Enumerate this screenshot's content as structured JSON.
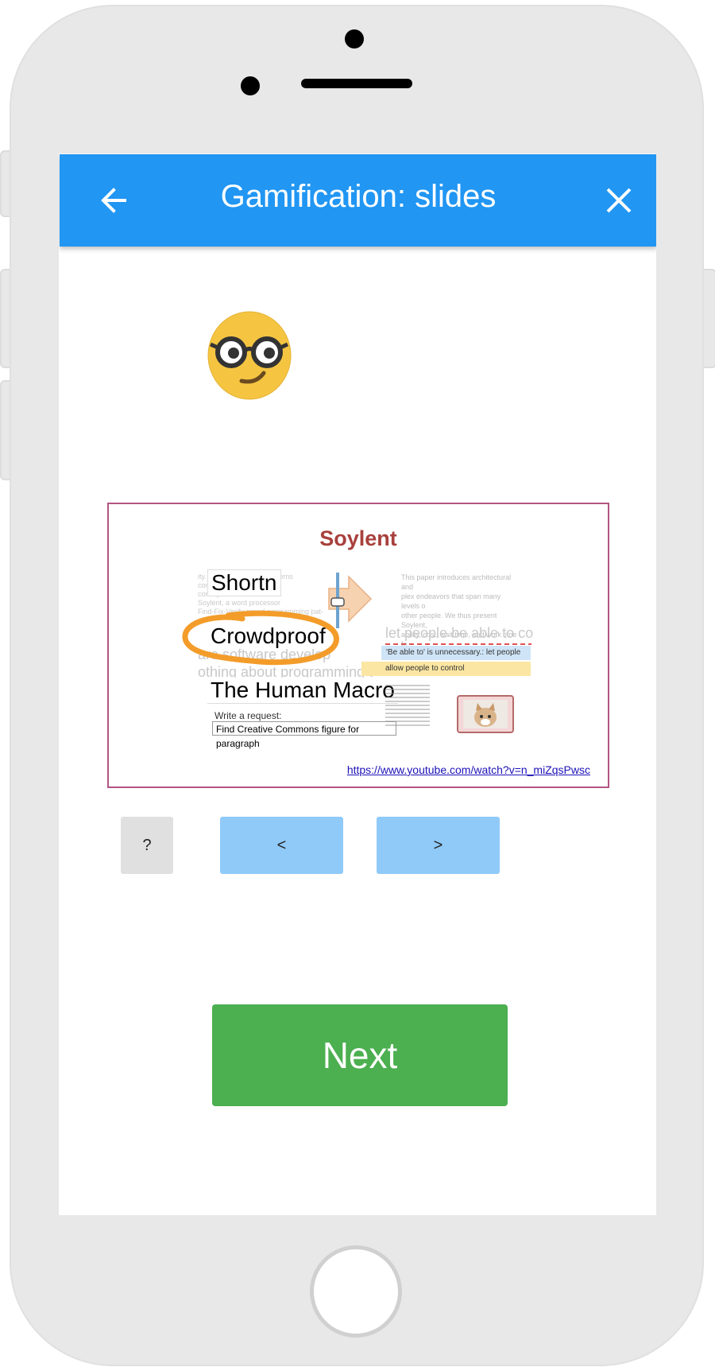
{
  "app": {
    "title": "Gamification: slides"
  },
  "icons": {
    "back": "arrow-left-icon",
    "close": "close-icon",
    "emoji": "nerd-face-emoji"
  },
  "slide": {
    "title": "Soylent",
    "labels": {
      "shortn": "Shortn",
      "crowdproof": "Crowdproof",
      "human_macro": "The Human Macro"
    },
    "request_label": "Write a request:",
    "request_input": "Find Creative Commons figure for paragraph",
    "suggestion_phrase": "let people be able to co",
    "suggestion_1": "'Be able to' is unnecessary.: let people",
    "suggestion_2": "allow people to control",
    "link": "https://www.youtube.com/watch?v=n_miZqsPwsc"
  },
  "controls": {
    "help_label": "?",
    "prev_label": "<",
    "next_slide_label": ">",
    "next_label": "Next"
  },
  "colors": {
    "appbar": "#2196f3",
    "next_button": "#4caf50",
    "slide_button": "#90caf9",
    "help_button": "#e0e0e0",
    "slide_title": "#a8403c",
    "slide_border": "#b25582",
    "annotation_circle": "#f39c2a"
  }
}
